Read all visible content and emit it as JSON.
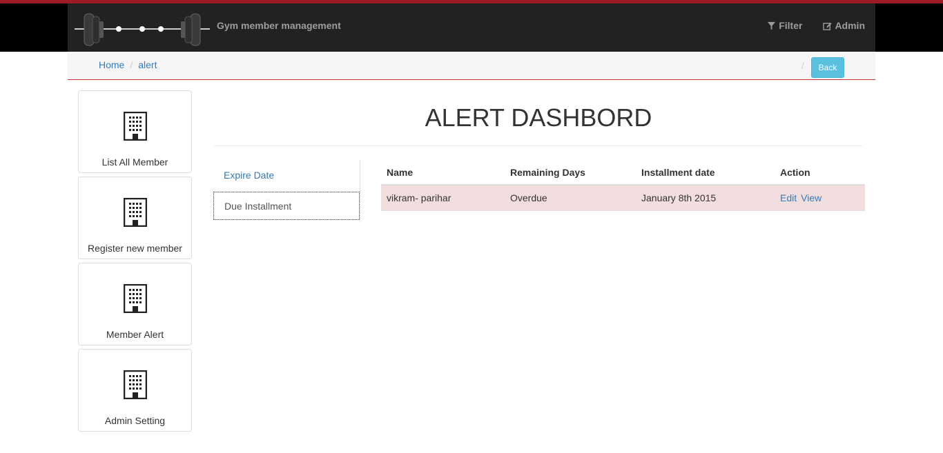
{
  "header": {
    "brand": "Gym member management",
    "nav": [
      {
        "label": "Filter",
        "icon": "filter-icon"
      },
      {
        "label": "Admin",
        "icon": "edit-icon"
      }
    ]
  },
  "breadcrumb": {
    "items": [
      "Home",
      "alert"
    ],
    "separator": "/",
    "back_label": "Back"
  },
  "sidebar": {
    "items": [
      {
        "label": "List All Member",
        "icon": "building-icon"
      },
      {
        "label": "Register new member",
        "icon": "building-icon"
      },
      {
        "label": "Member Alert",
        "icon": "building-icon"
      },
      {
        "label": "Admin Setting",
        "icon": "building-icon"
      }
    ]
  },
  "main": {
    "title": "ALERT DASHBORD",
    "tabs": [
      {
        "label": "Expire Date",
        "active": false
      },
      {
        "label": "Due Installment",
        "active": true
      }
    ],
    "table": {
      "columns": [
        "Name",
        "Remaining Days",
        "Installment date",
        "Action"
      ],
      "rows": [
        {
          "name": "vikram- parihar",
          "remaining": "Overdue",
          "date": "January 8th 2015",
          "actions": [
            "Edit",
            "View"
          ]
        }
      ]
    }
  },
  "colors": {
    "accent_red": "#9c1c24",
    "link": "#337ab7",
    "info_button": "#5bc0de",
    "danger_row": "#f2dede"
  }
}
